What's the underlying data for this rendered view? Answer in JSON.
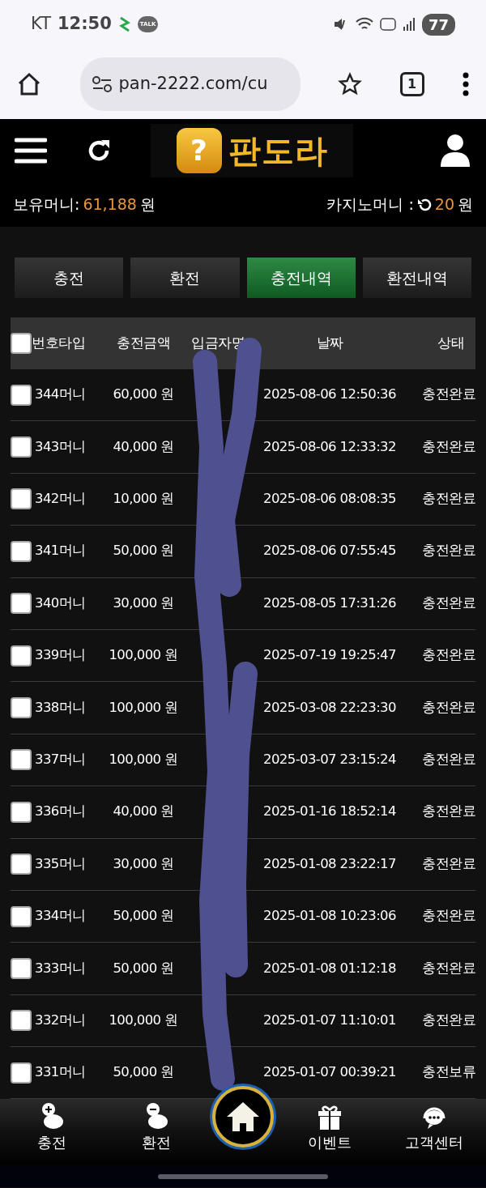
{
  "status_bar": {
    "carrier": "KT",
    "time": "12:50",
    "talk_label": "TALK",
    "battery": "77"
  },
  "browser": {
    "url": "pan-2222.com/cu",
    "tab_count": "1"
  },
  "header": {
    "logo_mark": "?",
    "logo_text": "판도라"
  },
  "wallet": {
    "label": "보유머니:",
    "amount": "61,188",
    "unit": "원"
  },
  "casino": {
    "label": "카지노머니 :",
    "amount": "20",
    "unit": "원"
  },
  "tabs": [
    {
      "label": "충전",
      "selected": false
    },
    {
      "label": "환전",
      "selected": false
    },
    {
      "label": "충전내역",
      "selected": true
    },
    {
      "label": "환전내역",
      "selected": false
    }
  ],
  "table": {
    "select_all_checked": false,
    "columns": [
      "번호타입",
      "충전금액",
      "입금자명",
      "날짜",
      "상태"
    ],
    "rows": [
      {
        "number": "344",
        "type": "머니",
        "amount": "60,000 원",
        "date": "2025-08-06 12:50:36",
        "status": "충전완료",
        "checked": false
      },
      {
        "number": "343",
        "type": "머니",
        "amount": "40,000 원",
        "date": "2025-08-06 12:33:32",
        "status": "충전완료",
        "checked": false
      },
      {
        "number": "342",
        "type": "머니",
        "amount": "10,000 원",
        "date": "2025-08-06 08:08:35",
        "status": "충전완료",
        "checked": false
      },
      {
        "number": "341",
        "type": "머니",
        "amount": "50,000 원",
        "date": "2025-08-06 07:55:45",
        "status": "충전완료",
        "checked": false
      },
      {
        "number": "340",
        "type": "머니",
        "amount": "30,000 원",
        "date": "2025-08-05 17:31:26",
        "status": "충전완료",
        "checked": false
      },
      {
        "number": "339",
        "type": "머니",
        "amount": "100,000 원",
        "date": "2025-07-19 19:25:47",
        "status": "충전완료",
        "checked": false
      },
      {
        "number": "338",
        "type": "머니",
        "amount": "100,000 원",
        "date": "2025-03-08 22:23:30",
        "status": "충전완료",
        "checked": false
      },
      {
        "number": "337",
        "type": "머니",
        "amount": "100,000 원",
        "date": "2025-03-07 23:15:24",
        "status": "충전완료",
        "checked": false
      },
      {
        "number": "336",
        "type": "머니",
        "amount": "40,000 원",
        "date": "2025-01-16 18:52:14",
        "status": "충전완료",
        "checked": false
      },
      {
        "number": "335",
        "type": "머니",
        "amount": "30,000 원",
        "date": "2025-01-08 23:22:17",
        "status": "충전완료",
        "checked": false
      },
      {
        "number": "334",
        "type": "머니",
        "amount": "50,000 원",
        "date": "2025-01-08 10:23:06",
        "status": "충전완료",
        "checked": false
      },
      {
        "number": "333",
        "type": "머니",
        "amount": "50,000 원",
        "date": "2025-01-08 01:12:18",
        "status": "충전완료",
        "checked": false
      },
      {
        "number": "332",
        "type": "머니",
        "amount": "100,000 원",
        "date": "2025-01-07 11:10:01",
        "status": "충전완료",
        "checked": false
      },
      {
        "number": "331",
        "type": "머니",
        "amount": "50,000 원",
        "date": "2025-01-07 00:39:21",
        "status": "충전보류",
        "checked": false
      }
    ]
  },
  "bottom_nav": [
    {
      "kind": "deposit",
      "label": "충전"
    },
    {
      "kind": "withdraw",
      "label": "환전"
    },
    {
      "kind": "home"
    },
    {
      "kind": "gift",
      "label": "이벤트"
    },
    {
      "kind": "support",
      "label": "고객센터"
    }
  ]
}
